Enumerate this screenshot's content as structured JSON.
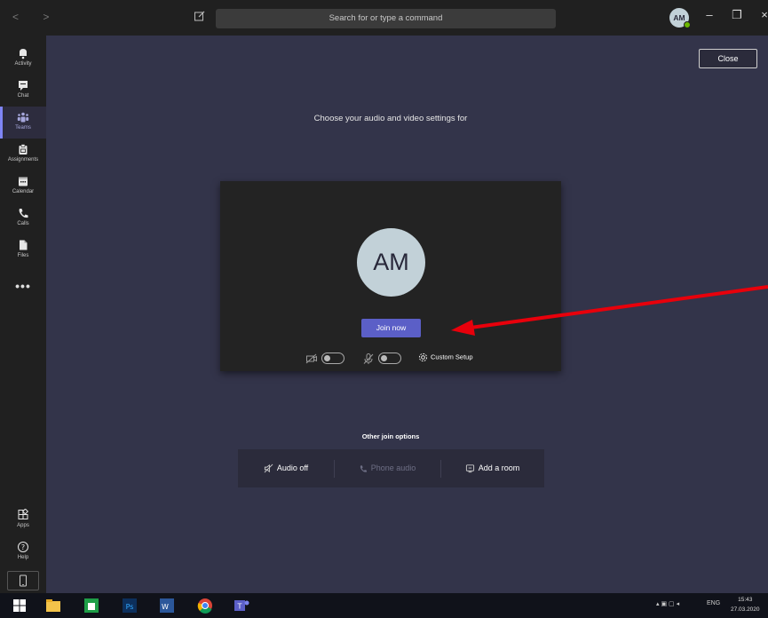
{
  "titlebar": {
    "search_placeholder": "Search for or type a command",
    "avatar_initials": "AM",
    "minimize_glyph": "–",
    "maximize_glyph": "❐",
    "close_glyph": "×",
    "nav_glyphs": "< >"
  },
  "rail": {
    "items": [
      {
        "label": "Activity",
        "icon": "bell-icon"
      },
      {
        "label": "Chat",
        "icon": "chat-icon"
      },
      {
        "label": "Teams",
        "icon": "teams-icon",
        "active": true
      },
      {
        "label": "Assignments",
        "icon": "assignments-icon"
      },
      {
        "label": "Calendar",
        "icon": "calendar-icon"
      },
      {
        "label": "Calls",
        "icon": "phone-icon"
      },
      {
        "label": "Files",
        "icon": "file-icon"
      }
    ],
    "more": "•••",
    "bottom": [
      {
        "label": "Apps",
        "icon": "apps-icon"
      },
      {
        "label": "Help",
        "icon": "help-icon"
      }
    ]
  },
  "main": {
    "close_label": "Close",
    "heading": "Choose your audio and video settings for",
    "avatar_initials": "AM",
    "join_label": "Join now",
    "custom_setup_label": "Custom Setup",
    "other_heading": "Other join options",
    "options": {
      "audio_off": "Audio off",
      "phone_audio": "Phone audio",
      "add_room": "Add a room"
    }
  },
  "taskbar": {
    "language": "ENG",
    "time": "15:43",
    "date": "27.03.2020"
  },
  "colors": {
    "accent": "#5b5fc7",
    "background": "#33344a",
    "annotation_arrow": "#e8000b"
  }
}
